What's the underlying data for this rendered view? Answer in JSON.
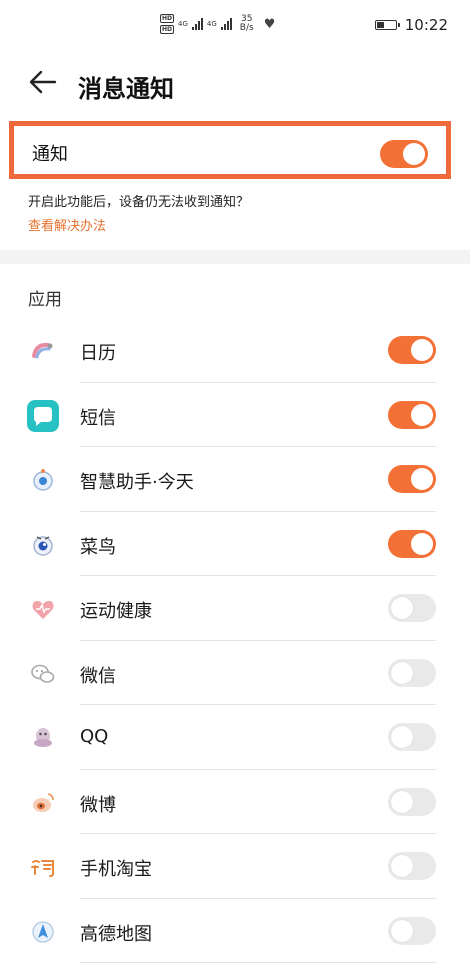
{
  "status_bar": {
    "hd1": "HD",
    "hd2": "HD",
    "net1": "4G",
    "net2": "4G",
    "speed_value": "35",
    "speed_unit": "B/s",
    "time": "10:22"
  },
  "header": {
    "title": "消息通知"
  },
  "master": {
    "label": "通知",
    "enabled": true
  },
  "hint": {
    "text": "开启此功能后，设备仍无法收到通知？",
    "link": "查看解决办法"
  },
  "section_title": "应用",
  "apps": [
    {
      "name": "日历",
      "enabled": true,
      "icon": "calendar-icon"
    },
    {
      "name": "短信",
      "enabled": true,
      "icon": "messages-icon"
    },
    {
      "name": "智慧助手·今天",
      "enabled": true,
      "icon": "assistant-icon"
    },
    {
      "name": "菜鸟",
      "enabled": true,
      "icon": "cainiao-icon"
    },
    {
      "name": "运动健康",
      "enabled": false,
      "icon": "health-icon"
    },
    {
      "name": "微信",
      "enabled": false,
      "icon": "wechat-icon"
    },
    {
      "name": "QQ",
      "enabled": false,
      "icon": "qq-icon"
    },
    {
      "name": "微博",
      "enabled": false,
      "icon": "weibo-icon"
    },
    {
      "name": "手机淘宝",
      "enabled": false,
      "icon": "taobao-icon"
    },
    {
      "name": "高德地图",
      "enabled": false,
      "icon": "amap-icon"
    }
  ],
  "colors": {
    "accent": "#f37137",
    "highlight_border": "#ee6a3d",
    "link": "#e8702f",
    "toggle_off": "#e9e9e9"
  }
}
